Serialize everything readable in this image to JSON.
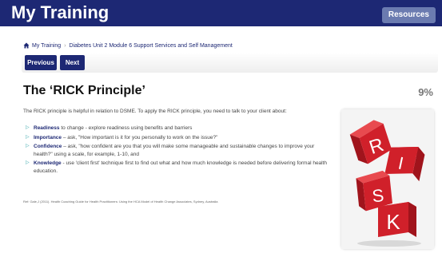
{
  "header": {
    "title": "My Training",
    "resources_label": "Resources"
  },
  "breadcrumb": {
    "home_label": "My Training",
    "current": "Diabetes Unit 2 Module 6 Support Services and Self Management"
  },
  "nav": {
    "previous_label": "Previous",
    "next_label": "Next"
  },
  "content": {
    "title": "The ‘RICK Principle’",
    "progress": "9%",
    "intro": "The RICK principle is helpful in relation to DSME. To apply the RICK principle, you need to talk to your client about:",
    "items": [
      {
        "term": "Readiness",
        "text": " to change - explore readiness using benefits and barriers"
      },
      {
        "term": "Importance",
        "text": " – ask, \"How important is it for you personally to work on the issue?\""
      },
      {
        "term": "Confidence",
        "text": " – ask, \"how confident are you that you will make some manageable and sustainable changes to improve your health?\" using a scale, for example, 1-10, and"
      },
      {
        "term": "Knowledge",
        "text": " - use 'client first' technique first to find out what and how much knowledge is needed before delivering formal health education."
      }
    ],
    "reference": "Ref: Gale,J (2011). Health Coaching Guide for Health Practitioners: Using the HCA Model of Health Change Associates, Sydney, Australia",
    "image_letters": [
      "R",
      "I",
      "S",
      "K"
    ]
  },
  "icons": {
    "home": "home-icon",
    "bullet": "triangle-right-icon"
  },
  "colors": {
    "header_bg": "#1d2874",
    "button_bg": "#1d2874",
    "accent": "#2fa3a8",
    "dice_red": "#d0202a"
  }
}
